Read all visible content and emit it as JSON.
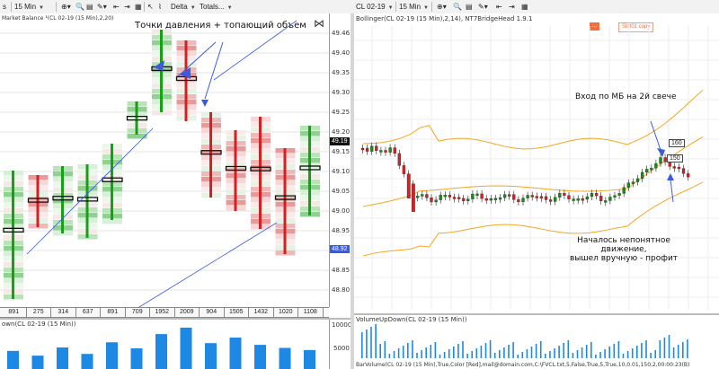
{
  "toolbar": {
    "left_instrument": "s",
    "left_timeframe": "15 Min",
    "left_tools": [
      "Delta",
      "Totals..."
    ],
    "right_instrument": "CL 02-19",
    "right_timeframe": "15 Min"
  },
  "left_chart": {
    "indicator_label": "Market Balance ¹(CL 02-19 (15 Min),2,20)",
    "annotation": "Точки давления + топающий объем",
    "price_axis": [
      "49.46",
      "49.40",
      "49.35",
      "49.30",
      "49.25",
      "49.20",
      "49.15",
      "49.10",
      "49.05",
      "49.00",
      "48.95",
      "48.90",
      "48.85",
      "48.80"
    ],
    "last_price": "49.19",
    "low_tag": "48.92",
    "bar_totals": [
      "891",
      "275",
      "314",
      "637",
      "891",
      "709",
      "1952",
      "2009",
      "904",
      "1505",
      "1432",
      "1020",
      "1108"
    ],
    "volume_label": "own(CL 02-19 (15 Min))",
    "volume_axis": [
      "10000",
      "5000"
    ],
    "volume_values": [
      4200,
      3100,
      5000,
      3500,
      6200,
      4800,
      8100,
      9600,
      6000,
      7300,
      5600,
      4900,
      4400
    ]
  },
  "right_chart": {
    "indicator_label": "Bollinger(CL 02-19 (15 Min),2,14), NT7BridgeHead 1.9.1",
    "chip_red": "...",
    "chip_blue": "Slot01 copy",
    "annotation_entry": "Вход по МБ на 2й свече",
    "annotation_exit_line1": "Началось непонятное движение,",
    "annotation_exit_line2": "вышел вручную - профит",
    "qty_top": "160",
    "qty_bottom": "150",
    "volume_label": "VolumeUpDown(CL 02-19 (15 Min))",
    "bottom_label": "BarVolume(CL 02-19 (15 Min),True,Color [Red],mail@domain.com,C:\\FVCL.txt,5,False,True,5,True,10,0.01,150,2,00:00:23(B)",
    "colors": {
      "up": "#1a8a1a",
      "down": "#d42020",
      "band": "#f5a623",
      "accent": "#3b5bdb"
    }
  }
}
